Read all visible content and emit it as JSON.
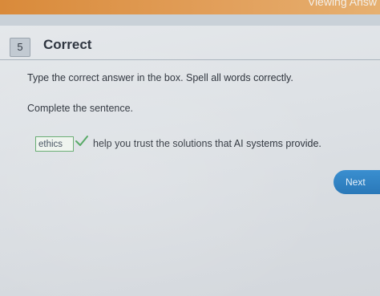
{
  "window": {
    "viewing_label": "Viewing Answ"
  },
  "question": {
    "number": "5",
    "status": "Correct",
    "instruction": "Type the correct answer in the box. Spell all words correctly.",
    "prompt": "Complete the sentence.",
    "answer_value": "ethics",
    "sentence_rest": "help you trust the solutions that AI systems provide."
  },
  "buttons": {
    "next_label": "Next"
  },
  "icons": {
    "correct_mark": "checkmark-icon"
  },
  "colors": {
    "top_bar": "#d98a3a",
    "correct_green": "#5fa86a",
    "next_button": "#2a78b8"
  }
}
